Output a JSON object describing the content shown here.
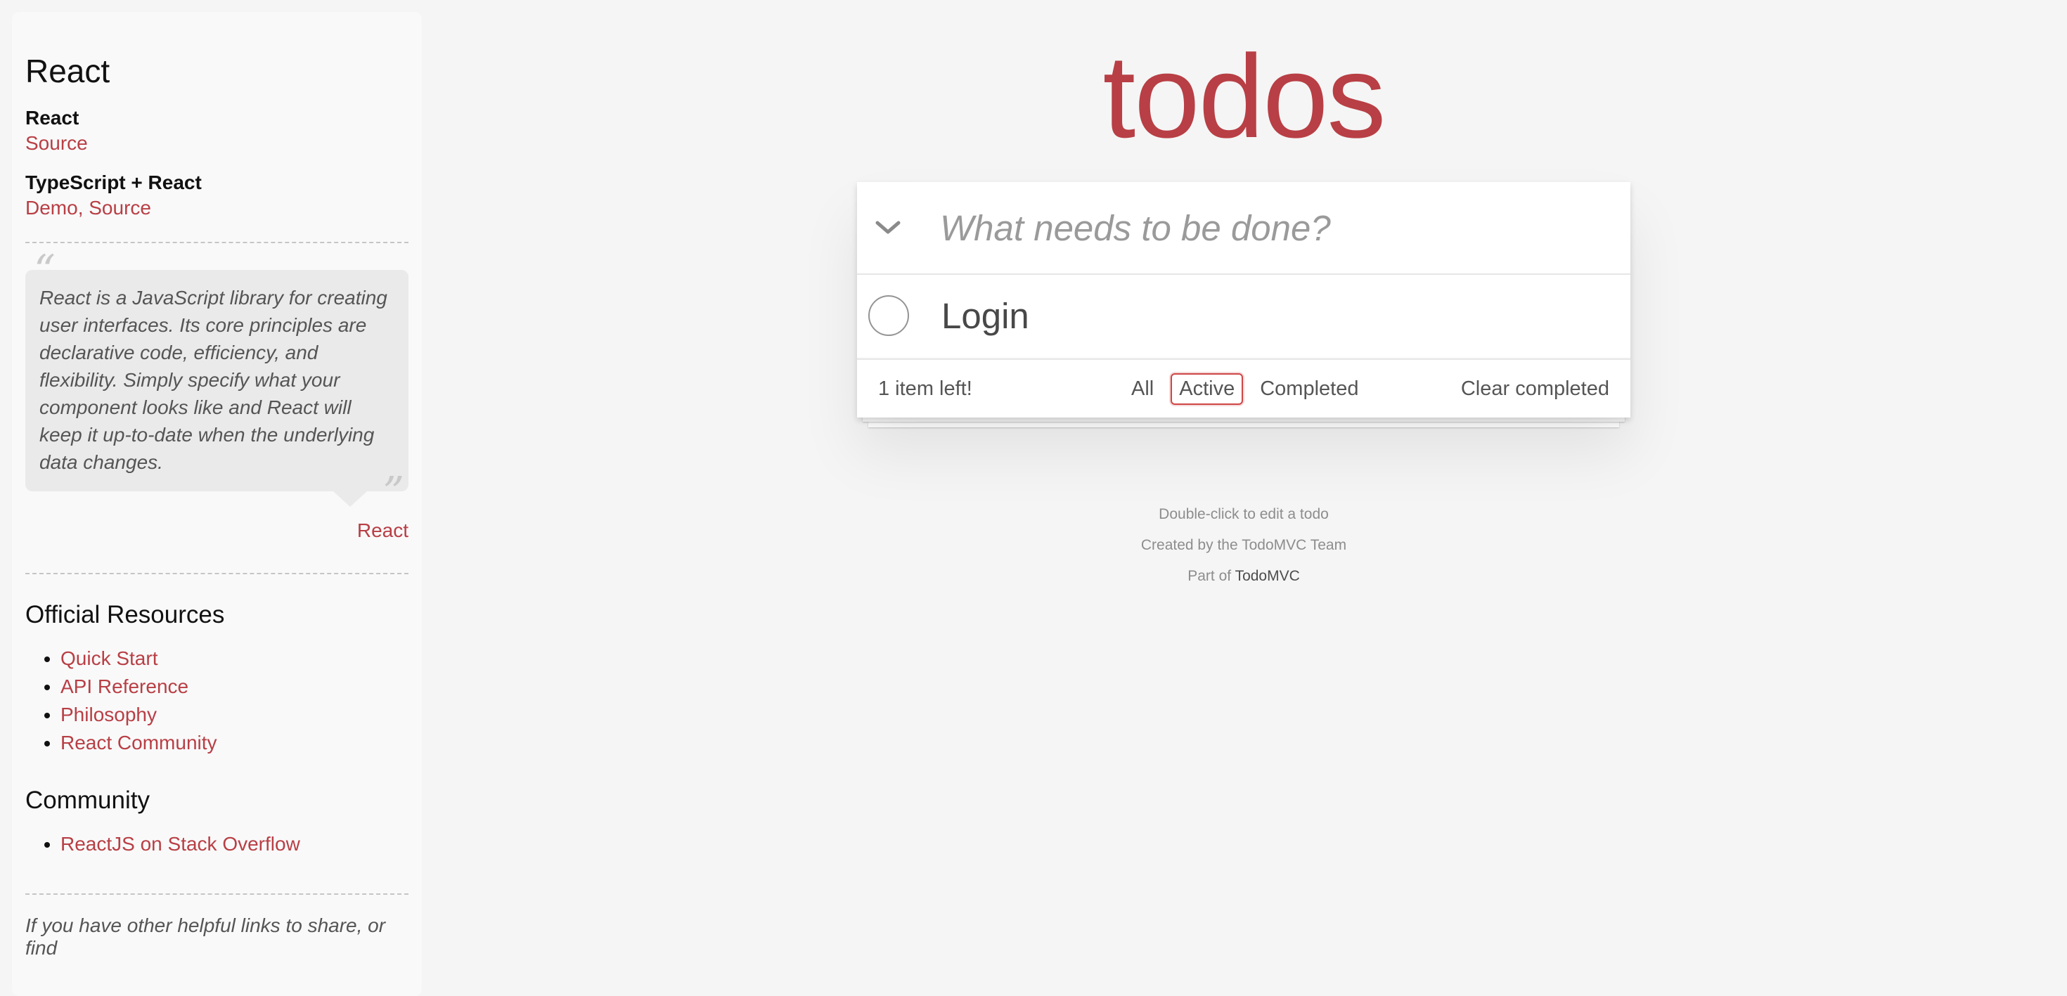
{
  "sidebar": {
    "title": "React",
    "examples": [
      {
        "title": "React",
        "links": "Source"
      },
      {
        "title": "TypeScript + React",
        "links": "Demo, Source"
      }
    ],
    "quote": {
      "text": "React is a JavaScript library for creating user interfaces. Its core principles are declarative code, efficiency, and flexibility. Simply specify what your component looks like and React will keep it up-to-date when the underlying data changes.",
      "source": "React"
    },
    "official_resources": {
      "heading": "Official Resources",
      "items": [
        "Quick Start",
        "API Reference",
        "Philosophy",
        "React Community"
      ]
    },
    "community": {
      "heading": "Community",
      "items": [
        "ReactJS on Stack Overflow"
      ]
    },
    "footer_text": "If you have other helpful links to share, or find"
  },
  "app": {
    "title": "todos",
    "new_todo_placeholder": "What needs to be done?",
    "todos": [
      {
        "label": "Login",
        "completed": false
      }
    ],
    "footer": {
      "count_text": "1 item left!",
      "filters": [
        "All",
        "Active",
        "Completed"
      ],
      "selected_filter": "Active",
      "clear_completed": "Clear completed"
    }
  },
  "info": {
    "line1": "Double-click to edit a todo",
    "line2": "Created by the TodoMVC Team",
    "line3_prefix": "Part of ",
    "line3_link": "TodoMVC"
  },
  "colors": {
    "accent": "#b83f45",
    "background": "#f5f5f5",
    "selected_filter_border": "#ce4646"
  }
}
